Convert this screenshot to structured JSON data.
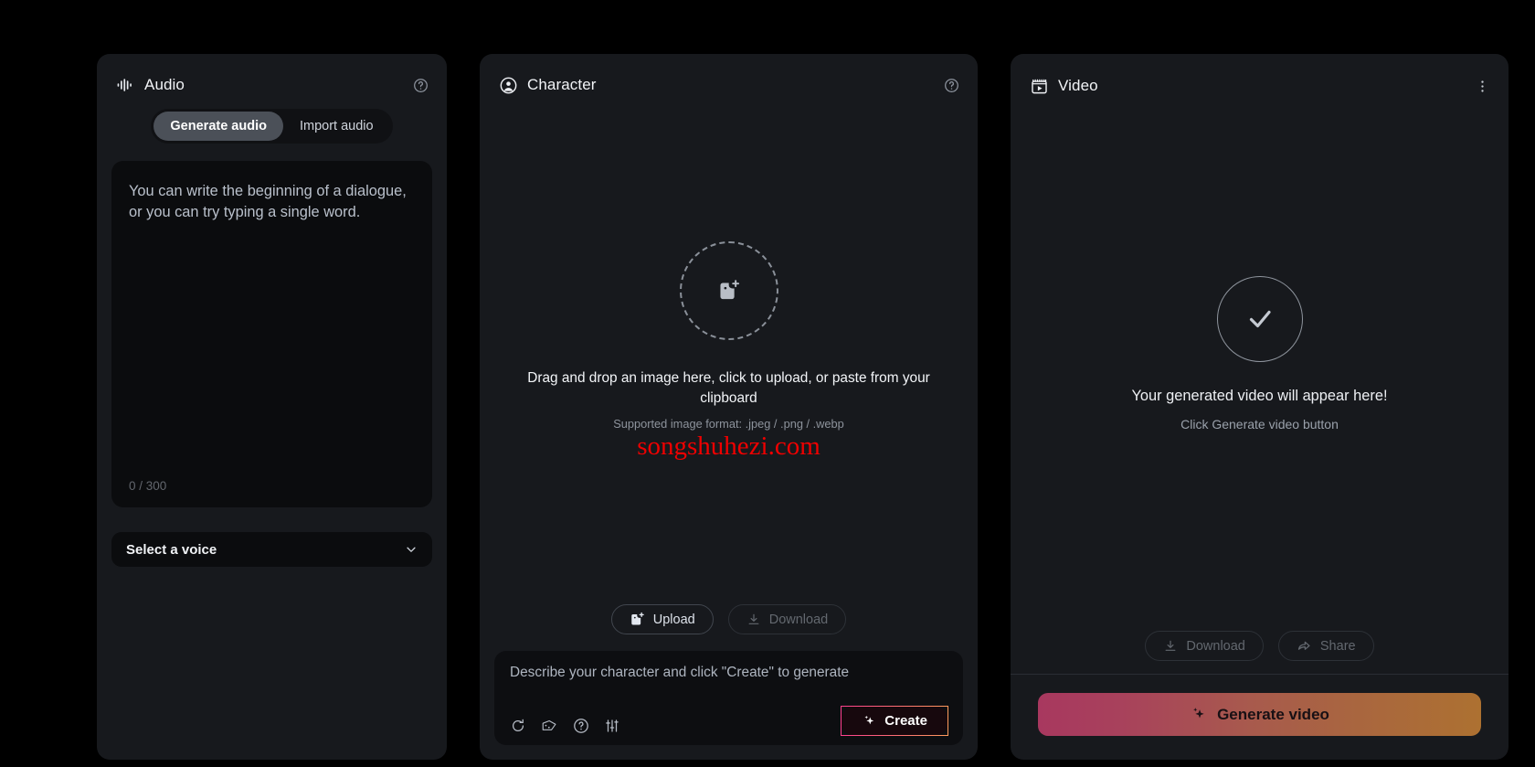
{
  "audio": {
    "title": "Audio",
    "title_icon": "waveform-icon",
    "help_icon": "help-circle-icon",
    "tabs": [
      {
        "label": "Generate audio",
        "active": true
      },
      {
        "label": "Import audio",
        "active": false
      }
    ],
    "prompt_placeholder": "You can write the beginning of a dialogue, or you can try typing a single word.",
    "prompt_value": "",
    "char_count": "0 / 300",
    "voice_select_label": "Select a voice",
    "voice_select_icon": "chevron-down-icon"
  },
  "character": {
    "title": "Character",
    "title_icon": "user-circle-icon",
    "help_icon": "help-circle-icon",
    "dropzone_icon": "image-plus-icon",
    "drop_text": "Drag and drop an image here, click to upload, or paste from your clipboard",
    "drop_sub": "Supported image format: .jpeg / .png / .webp",
    "watermark": "songshuhezi.com",
    "upload_label": "Upload",
    "upload_icon": "image-plus-icon",
    "download_label": "Download",
    "download_icon": "download-icon",
    "prompt_placeholder": "Describe your character and click \"Create\" to generate",
    "prompt_value": "",
    "tools": [
      {
        "name": "refresh-icon"
      },
      {
        "name": "dice-icon"
      },
      {
        "name": "help-circle-icon"
      },
      {
        "name": "sliders-icon"
      }
    ],
    "create_label": "Create",
    "create_icon": "sparkle-icon"
  },
  "video": {
    "title": "Video",
    "title_icon": "clapperboard-icon",
    "menu_icon": "more-vertical-icon",
    "status_icon": "check-icon",
    "empty_title": "Your generated video will appear here!",
    "empty_sub": "Click Generate video button",
    "download_label": "Download",
    "download_icon": "download-icon",
    "share_label": "Share",
    "share_icon": "share-icon",
    "generate_label": "Generate video",
    "generate_icon": "sparkle-icon"
  },
  "colors": {
    "background": "#000000",
    "panel": "#17191d",
    "inset": "#0b0c0e",
    "accent_pink": "#ff3f8e",
    "accent_orange": "#ad7131",
    "watermark_red": "#ef0000"
  }
}
